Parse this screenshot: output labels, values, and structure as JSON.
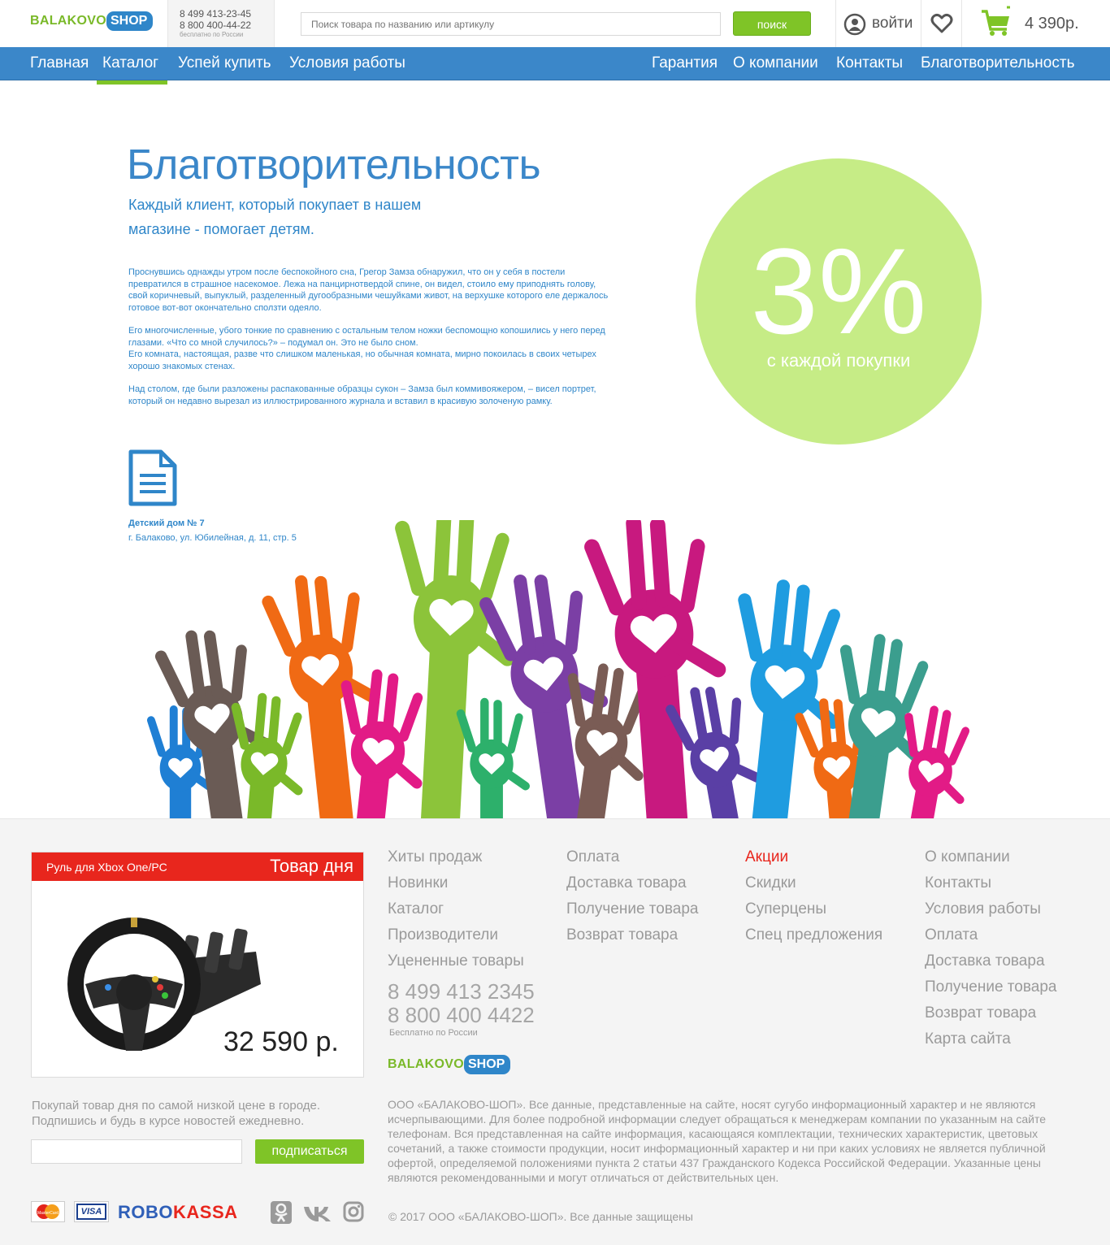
{
  "header": {
    "logo": {
      "word1": "BALAKOVO",
      "word2": "SHOP"
    },
    "phones": {
      "phone1": "8 499 413-23-45",
      "phone2": "8 800 400-44-22",
      "free": "бесплатно по России"
    },
    "search_placeholder": "Поиск товара по названию или артикулу",
    "search_button": "поиск",
    "login": "войти",
    "cart_total": "4 390р."
  },
  "nav": {
    "left": [
      "Главная",
      "Каталог",
      "Успей купить",
      "Условия работы"
    ],
    "active": "Каталог",
    "right": [
      "Гарантия",
      "О компании",
      "Контакты",
      "Благотворительность"
    ]
  },
  "main": {
    "title": "Благотворительность",
    "subtitle": "Каждый клиент, который покупает в нашем магазине - помогает детям.",
    "paragraphs": [
      "Проснувшись однажды утром после беспокойного сна, Грегор Замза обнаружил, что он у себя в постели превратился в страшное насекомое. Лежа на панцирнотвердой спине, он видел, стоило ему приподнять голову, свой коричневый, выпуклый, разделенный дугообразными чешуйками живот, на верхушке которого еле держалось готовое вот-вот окончательно сползти одеяло.",
      "Его многочисленные, убого тонкие по сравнению с остальным телом ножки беспомощно копошились у него перед глазами. «Что со мной случилось?» – подумал он. Это не было сном.",
      "Его комната, настоящая, разве что слишком маленькая, но обычная комната, мирно покоилась в своих четырех хорошо знакомых стенах.",
      "Над столом, где были разложены распакованные образцы сукон – Замза был коммивояжером, – висел портрет, который он недавно вырезал из иллюстрированного журнала и вставил в красивую золоченую рамку."
    ],
    "circle": {
      "percent": "3%",
      "caption": "с каждой покупки"
    },
    "org": {
      "name": "Детский дом № 7",
      "address": "г. Балаково, ул. Юбилейная, д. 11, стр. 5"
    }
  },
  "deal": {
    "name": "Руль для Xbox One/PC",
    "tag": "Товар дня",
    "price": "32 590 р."
  },
  "subscribe": {
    "text": "Покупай товар дня по самой низкой цене в городе. Подпишись и будь в курсе новостей ежедневно.",
    "button": "подписаться"
  },
  "footer": {
    "col1": [
      "Хиты продаж",
      "Новинки",
      "Каталог",
      "Производители",
      "Уцененные товары"
    ],
    "col2": [
      "Оплата",
      "Доставка товара",
      "Получение товара",
      "Возврат товара"
    ],
    "col3": [
      "Акции",
      "Скидки",
      "Суперцены",
      "Спец предложения"
    ],
    "col4": [
      "О компании",
      "Контакты",
      "Условия работы",
      "Оплата",
      "Доставка товара",
      "Получение товара",
      "Возврат товара",
      "Карта сайта"
    ],
    "phone1": "8 499 413 2345",
    "phone2": "8 800 400 4422",
    "free": "Бесплатно по России",
    "legal": "ООО «БАЛАКОВО-ШОП». Все данные, представленные на сайте, носят сугубо информационный характер и не являются исчерпывающими. Для более подробной информации следует обращаться к менеджерам компании по указанным на сайте телефонам. Вся представленная на сайте информация, касающаяся комплектации, технических характеристик, цветовых сочетаний, а также стоимости продукции, носит информационный характер и ни при каких условиях не является публичной офертой, определяемой положениями пункта 2 статьи 437 Гражданского Кодекса Российской Федерации. Указанные цены являются рекомендованными и могут отличаться от действительных цен.",
    "copyright": "© 2017 ООО «БАЛАКОВО-ШОП». Все данные защищены",
    "payments": {
      "mastercard": "MasterCard",
      "visa": "VISA",
      "robokassa_1": "ROBO",
      "robokassa_2": "KASSA"
    }
  },
  "colors": {
    "brand_blue": "#3b87c9",
    "brand_green": "#7fc427",
    "red": "#e8261d",
    "circle": "#c6ec86"
  },
  "icons": [
    "user-icon",
    "heart-icon",
    "cart-icon",
    "document-icon",
    "odnoklassniki-icon",
    "vk-icon",
    "instagram-icon"
  ]
}
